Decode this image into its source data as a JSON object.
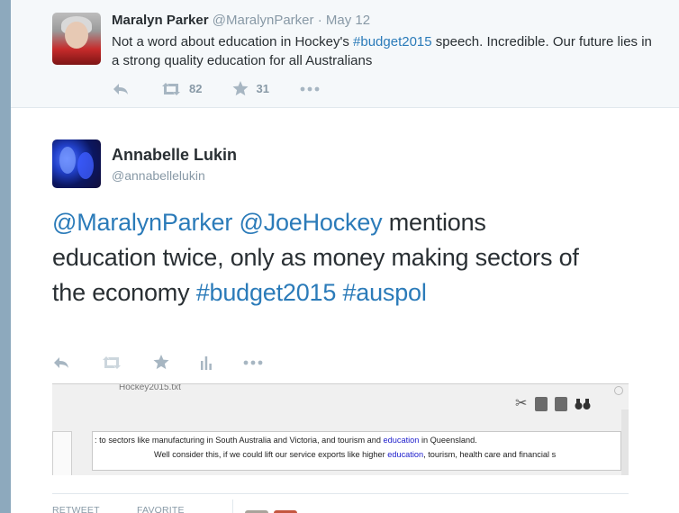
{
  "parent_tweet": {
    "fullname": "Maralyn Parker",
    "username": "@MaralynParker",
    "separator": "·",
    "date": "May 12",
    "text_before": "Not a word about education in Hockey's ",
    "hashtag": "#budget2015",
    "text_after": " speech. Incredible. Our future lies in a strong quality education for all Australians",
    "retweets": "82",
    "favorites": "31"
  },
  "main_tweet": {
    "fullname": "Annabelle Lukin",
    "username": "@annabellelukin",
    "mention1": "@MaralynParker",
    "mention2": "@JoeHockey",
    "text_body": " mentions education twice, only as money making sectors of the economy ",
    "hashtag1": "#budget2015",
    "hashtag2": "#auspol"
  },
  "media": {
    "window_title": "Hockey2015.txt",
    "line1_before": ": to sectors like manufacturing in South Australia and Victoria, and tourism and ",
    "line1_highlight": "education",
    "line1_after": " in Queensland.",
    "line2_before": "Well consider this, if we could lift our service exports like higher ",
    "line2_highlight": "education",
    "line2_after": ", tourism, health care and financial s"
  },
  "stats": {
    "retweets_label": "RETWEET",
    "favorites_label": "FAVORITE"
  },
  "colors": {
    "link": "#2b7bb9",
    "text": "#292f33",
    "muted": "#8899a6",
    "icon": "#a7b6c2"
  }
}
